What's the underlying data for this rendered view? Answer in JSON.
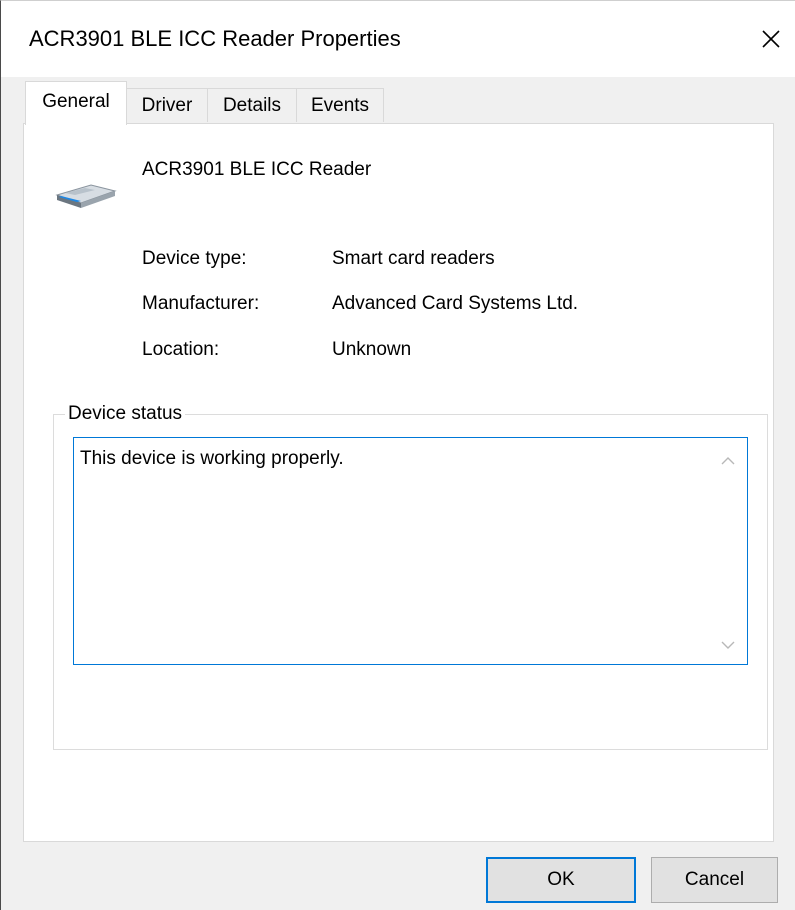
{
  "window": {
    "title": "ACR3901 BLE ICC Reader Properties",
    "close_icon": "close-icon"
  },
  "tabs": [
    {
      "label": "General",
      "active": true
    },
    {
      "label": "Driver",
      "active": false
    },
    {
      "label": "Details",
      "active": false
    },
    {
      "label": "Events",
      "active": false
    }
  ],
  "device": {
    "icon": "smart-card-reader-icon",
    "name": "ACR3901 BLE ICC Reader",
    "properties": [
      {
        "label": "Device type:",
        "value": "Smart card readers"
      },
      {
        "label": "Manufacturer:",
        "value": "Advanced Card Systems Ltd."
      },
      {
        "label": "Location:",
        "value": "Unknown"
      }
    ]
  },
  "status": {
    "group_label": "Device status",
    "text": "This device is working properly."
  },
  "buttons": {
    "ok_label": "OK",
    "cancel_label": "Cancel"
  },
  "colors": {
    "accent": "#0078d7",
    "window_bg": "#f0f0f0",
    "panel_bg": "#ffffff"
  }
}
